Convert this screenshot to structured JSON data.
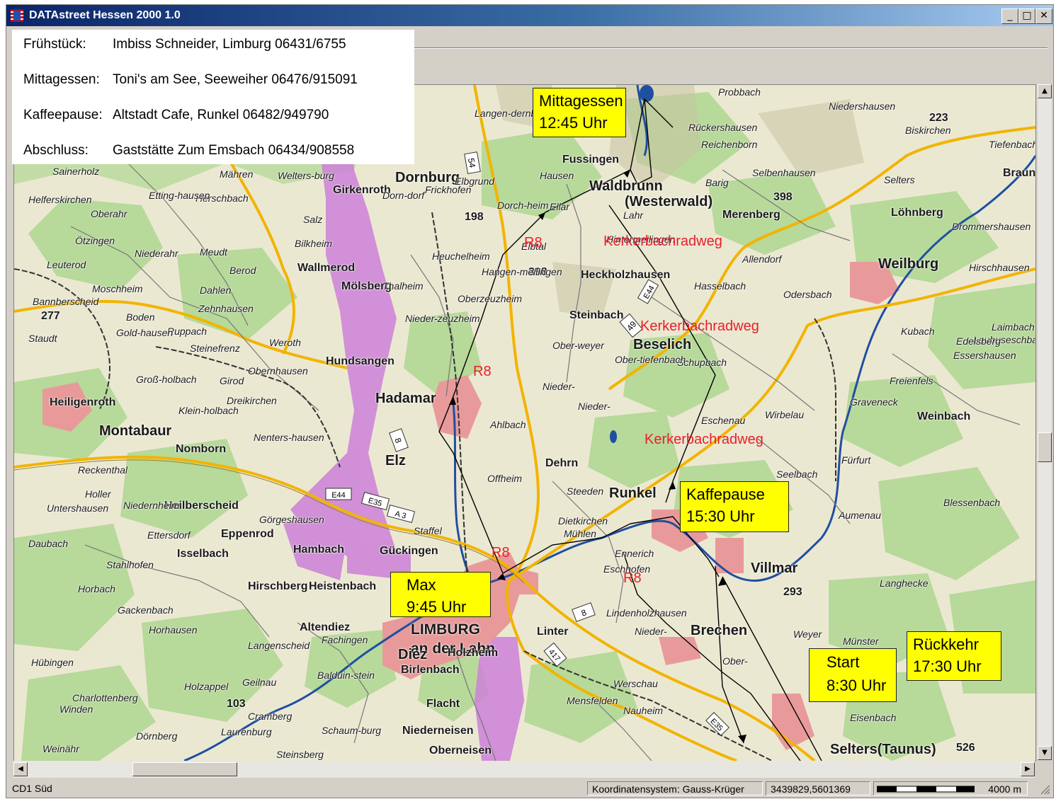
{
  "window": {
    "title": "DATAstreet Hessen 2000 1.0",
    "minimize": "_",
    "maximize": "□",
    "close": "✕"
  },
  "info_panel": {
    "rows": [
      {
        "label": "Frühstück:",
        "value": "Imbiss Schneider, Limburg 06431/6755"
      },
      {
        "label": "Mittagessen:",
        "value": "Toni's am See, Seeweiher 06476/915091"
      },
      {
        "label": "Kaffeepause:",
        "value": "Altstadt Cafe, Runkel 06482/949790"
      },
      {
        "label": "Abschluss:",
        "value": "Gaststätte Zum Emsbach 06434/908558"
      }
    ]
  },
  "callouts": {
    "mittagessen": {
      "title": "Mittagessen",
      "time": "12:45 Uhr"
    },
    "kaffeepause": {
      "title": "Kaffepause",
      "time": "15:30 Uhr"
    },
    "max": {
      "title": "Max",
      "time": "9:45 Uhr"
    },
    "start": {
      "title": "Start",
      "time": "8:30 Uhr"
    },
    "rueckkehr": {
      "title": "Rückkehr",
      "time": "17:30 Uhr"
    }
  },
  "route_labels": {
    "r8_1": "R8",
    "r8_2": "R8",
    "r8_3": "R8",
    "r8_4": "R8",
    "kerkerbach_1": "Kerkerbachradweg",
    "kerkerbach_2": "Kerkerbachradweg",
    "kerkerbach_3": "Kerkerbachradweg"
  },
  "map": {
    "places": {
      "limburg": "LIMBURG",
      "an_der_lahn": "an der Lahn",
      "diez": "Diez",
      "hadamar": "Hadamar",
      "elz": "Elz",
      "montabaur": "Montabaur",
      "weilburg": "Weilburg",
      "runkel": "Runkel",
      "villmar": "Villmar",
      "brechen": "Brechen",
      "selters": "Selters(Taunus)",
      "beselich": "Beselich",
      "waldbrunn": "Waldbrunn",
      "westerwald": "(Westerwald)",
      "dornburg": "Dornburg",
      "merenberg": "Merenberg",
      "heistenbach": "Heistenbach",
      "hambach": "Hambach",
      "gueckingen": "Gückingen",
      "weinbach": "Weinbach",
      "nomborn": "Nomborn",
      "heiligenroth": "Heiligenroth",
      "hundsangen": "Hundsangen",
      "wallmerod": "Wallmerod",
      "dehrn": "Dehrn",
      "linter": "Linter",
      "holzheim": "Holzheim",
      "birlenbach": "Birlenbach",
      "hirschberg": "Hirschberg",
      "altendiez": "Altendiez",
      "isselbach": "Isselbach",
      "eppenrod": "Eppenrod",
      "heilberscheid": "Heilberscheid",
      "niederneisen": "Niederneisen",
      "oberneisen": "Oberneisen",
      "flacht": "Flacht",
      "mensfelden": "Mensfelden",
      "nauheim": "Nauheim",
      "werschau": "Werschau",
      "steinbach": "Steinbach",
      "heckholzhausen": "Heckholzhausen",
      "fussingen": "Fussingen",
      "hausen": "Hausen",
      "lahr": "Lahr",
      "elbtal": "Elbtal",
      "thalheim": "Thalheim",
      "moelsberg": "Mölsberg",
      "salz": "Salz",
      "girkenroth": "Girkenroth",
      "frickhofen": "Frickhofen",
      "ahlbach": "Ahlbach",
      "offheim": "Offheim",
      "dietkirchen": "Dietkirchen",
      "eschhofen": "Eschhofen",
      "lindenholzhausen": "Lindenholzhausen",
      "niederbrechen": "Nieder-",
      "oberbrechen": "Ober-",
      "weyer": "Weyer",
      "muenster": "Münster",
      "eisenbach": "Eisenbach",
      "kubach": "Kubach",
      "laubuseschbach": "Laubuseschbach",
      "langhecke": "Langhecke",
      "aumenau": "Aumenau",
      "fuerfurt": "Fürfurt",
      "graveneck": "Graveneck",
      "freienfels": "Freienfels",
      "edelsberg": "Edelsberg",
      "essershausen": "Essershausen",
      "laimbach": "Laimbach",
      "hirschhausen": "Hirschhausen",
      "drommershausen": "Drommershausen",
      "loehnberg": "Löhnberg",
      "selters_w": "Selters",
      "allendorf": "Allendorf",
      "hasselbach": "Hasselbach",
      "odersbach": "Odersbach",
      "schupbach": "Schupbach",
      "wirbelau": "Wirbelau",
      "seelbach": "Seelbach",
      "blessenbach": "Blessenbach",
      "eschenau": "Eschenau",
      "ellar": "Ellar",
      "rueckershausen": "Rückershausen",
      "reichenborn": "Reichenborn",
      "selbenhausen": "Selbenhausen",
      "barig": "Barig",
      "niedershausen": "Niedershausen",
      "biskirchen": "Biskirchen",
      "tiefenbach": "Tiefenbach",
      "probbach": "Probbach",
      "braun": "Braun",
      "langendernbach": "Langen-dernbach",
      "elsoff": "Mähren",
      "herschbach": "Herschbach",
      "etting": "Etting-hausen",
      "helferskirchen": "Helferskirchen",
      "oberahr": "Oberahr",
      "oetzingen": "Ötzingen",
      "niederahr": "Niederahr",
      "meudt": "Meudt",
      "berod": "Berod",
      "dahlen": "Dahlen",
      "zehnhausen": "Zehnhausen",
      "moschheim": "Moschheim",
      "boden": "Boden",
      "ruppach": "Ruppach",
      "goldhausen": "Gold-hausen",
      "steinefrenz": "Steinefrenz",
      "weroth": "Weroth",
      "obernhausen": "Obernhausen",
      "dreikirchen": "Dreikirchen",
      "girod": "Girod",
      "grossholbach": "Groß-holbach",
      "kleinholbach": "Klein-holbach",
      "nentershausen": "Nenters-hausen",
      "staudt": "Staudt",
      "bannberscheid": "Bannberscheid",
      "leuterod": "Leuterod",
      "bilkheim": "Bilkheim",
      "welters": "Welters-burg",
      "sainerholz": "Sainerholz",
      "reckenthal": "Reckenthal",
      "holler": "Holler",
      "untershausen": "Untershausen",
      "niedernheim": "Niedernheim",
      "daubach": "Daubach",
      "stahlhofen": "Stahlhofen",
      "horbach": "Horbach",
      "gackenbach": "Gackenbach",
      "horhausen": "Horhausen",
      "langenscheid": "Langenscheid",
      "huebingen": "Hübingen",
      "charlottenberg": "Charlottenberg",
      "winden": "Winden",
      "holzappel": "Holzappel",
      "geilnau": "Geilnau",
      "balduinstein": "Balduin-stein",
      "cramberg": "Cramberg",
      "laurenburg": "Laurenburg",
      "schaumburg": "Schaum-burg",
      "doernberg": "Dörnberg",
      "weinaehr": "Weinähr",
      "steinsberg": "Steinsberg",
      "goergeshausen": "Görgeshausen",
      "ettersdorf": "Ettersdorf",
      "fachingen": "Fachingen",
      "staffel": "Staffel",
      "muehlen": "Mühlen",
      "steeden": "Steeden",
      "ennerich": "Ennerich",
      "hangenmeilingen": "Hangen-meilingen",
      "oberzeuzheim": "Oberzeuzheim",
      "niederzeuzheim": "Nieder-zeuzheim",
      "heuchelheim": "Heuchelheim",
      "dorchheim": "Dorch-heim",
      "dorndorf": "Dorn-dorf",
      "elbgrund": "Elbgrund",
      "niedertiefenbach": "Nieder-",
      "obertiefenbach": "Ober-tiefenbach",
      "oberweyer": "Ober-weyer",
      "niederweyer": "Nieder-",
      "hinterhausen": "Hintermeilingen",
      "num_398a": "398",
      "num_398b": "398",
      "num_198": "198",
      "num_277": "277",
      "num_223": "223",
      "num_293": "293",
      "num_103": "103",
      "num_526": "526"
    },
    "road_numbers": {
      "b54": "54",
      "b8_north": "8",
      "b8_south": "8",
      "b49": "49",
      "e44_road": "E44",
      "e44_map": "E44",
      "e35": "E35",
      "a3": "A 3",
      "b417": "417",
      "e35_south": "E35"
    }
  },
  "statusbar": {
    "cd": "CD1 Süd",
    "coord_system": "Koordinatensystem: Gauss-Krüger",
    "coordinates": "3439829,5601369",
    "scale": "4000 m"
  },
  "scrollbars": {
    "up": "▲",
    "down": "▼",
    "left": "◀",
    "right": "▶"
  },
  "colors": {
    "title_gradient_start": "#0a246a",
    "title_gradient_end": "#a6caf0",
    "callout_bg": "#ffff00",
    "route_label": "#e8202a",
    "forest": "#a8d08d",
    "protected_area": "#cc80d8",
    "town": "#e89090",
    "river": "#1f4fa0",
    "road_major": "#f2b400"
  }
}
